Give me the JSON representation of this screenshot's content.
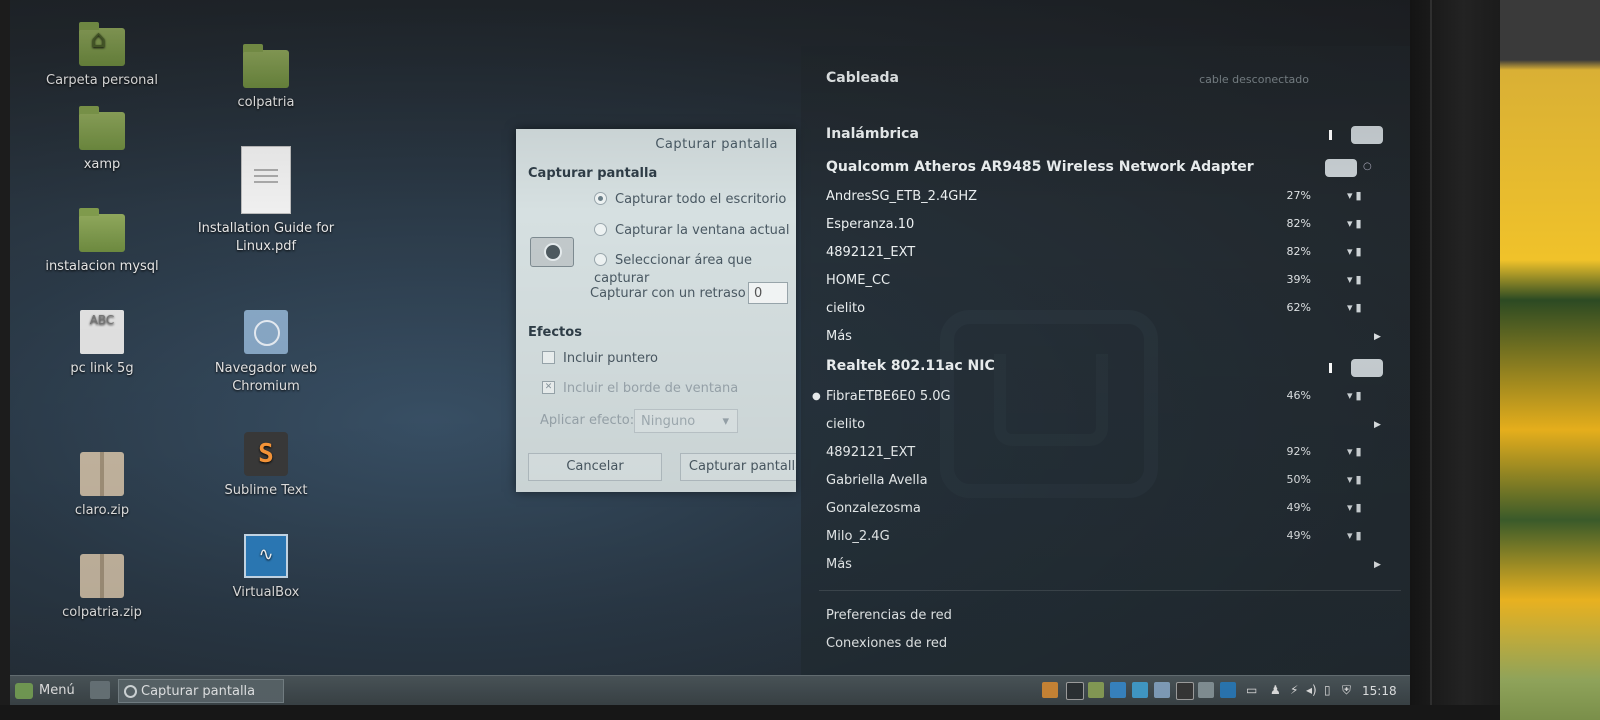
{
  "desktop": {
    "icons": [
      {
        "label": "Carpeta personal"
      },
      {
        "label": "colpatria"
      },
      {
        "label": "xamp"
      },
      {
        "label": "Installation Guide for Linux.pdf"
      },
      {
        "label": "instalacion mysql"
      },
      {
        "label": "pc link 5g"
      },
      {
        "label": "Navegador web Chromium"
      },
      {
        "label": "Sublime Text"
      },
      {
        "label": "claro.zip"
      },
      {
        "label": "VirtualBox"
      },
      {
        "label": "colpatria.zip"
      }
    ],
    "abc_text": "ABC",
    "sublime_letter": "S"
  },
  "dialog": {
    "title": "Capturar pantalla",
    "section_capture": "Capturar pantalla",
    "options": [
      {
        "label": "Capturar todo el escritorio",
        "selected": true
      },
      {
        "label": "Capturar la ventana actual",
        "selected": false
      },
      {
        "label": "Seleccionar área que capturar",
        "selected": false
      }
    ],
    "delay_label": "Capturar con un retraso de",
    "delay_value": "0",
    "section_effects": "Efectos",
    "include_pointer": "Incluir puntero",
    "include_border": "Incluir el borde de ventana",
    "apply_effect_label": "Aplicar efecto:",
    "apply_effect_value": "Ninguno",
    "cancel": "Cancelar",
    "capture": "Capturar pantalla"
  },
  "network": {
    "wired_header": "Cableada",
    "wired_status": "cable desconectado",
    "wireless_header": "Inalámbrica",
    "adapter1": "Qualcomm Atheros AR9485 Wireless Network Adapter",
    "adapter1_networks": [
      {
        "ssid": "AndresSG_ETB_2.4GHZ",
        "strength": "27%"
      },
      {
        "ssid": "Esperanza.10",
        "strength": "82%"
      },
      {
        "ssid": "4892121_EXT",
        "strength": "82%"
      },
      {
        "ssid": "HOME_CC",
        "strength": "39%"
      },
      {
        "ssid": "cielito",
        "strength": "62%"
      }
    ],
    "more1": "Más",
    "adapter2": "Realtek 802.11ac NIC",
    "adapter2_networks": [
      {
        "ssid": "FibraETBE6E0 5.0G",
        "strength": "46%",
        "connected": true
      },
      {
        "ssid": "cielito",
        "strength": "",
        "submenu": true
      },
      {
        "ssid": "4892121_EXT",
        "strength": "92%"
      },
      {
        "ssid": "Gabriella Avella",
        "strength": "50%"
      },
      {
        "ssid": "Gonzalezosma",
        "strength": "49%"
      },
      {
        "ssid": "Milo_2.4G",
        "strength": "49%"
      }
    ],
    "more2": "Más",
    "preferences": "Preferencias de red",
    "connections": "Conexiones de red"
  },
  "taskbar": {
    "menu_label": "Menú",
    "window_item": "Capturar pantalla",
    "clock": "15:18"
  },
  "colors": {
    "dialog_bg": "#d6e0e1",
    "folder_green": "#8fa75c",
    "taskbar": "#4f5a5f"
  }
}
